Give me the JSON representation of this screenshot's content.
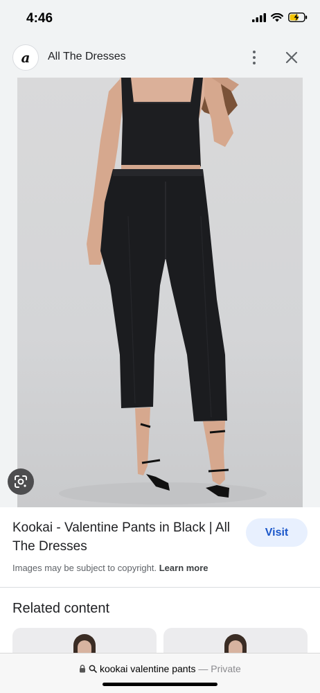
{
  "status_bar": {
    "time": "4:46"
  },
  "header": {
    "favicon_letter": "a",
    "site_name": "All The Dresses"
  },
  "image": {
    "description_icon": "lens-icon"
  },
  "result": {
    "title": "Kookai - Valentine Pants in Black | All The Dresses",
    "visit_label": "Visit",
    "copyright_text": "Images may be subject to copyright.",
    "learn_more_label": "Learn more"
  },
  "related": {
    "heading": "Related content"
  },
  "address_bar": {
    "query": "kookai valentine pants",
    "separator": "—",
    "mode": "Private"
  },
  "colors": {
    "accent": "#1a56c9",
    "visit_bg": "#e8f0fe",
    "header_bg": "#f1f3f4"
  }
}
